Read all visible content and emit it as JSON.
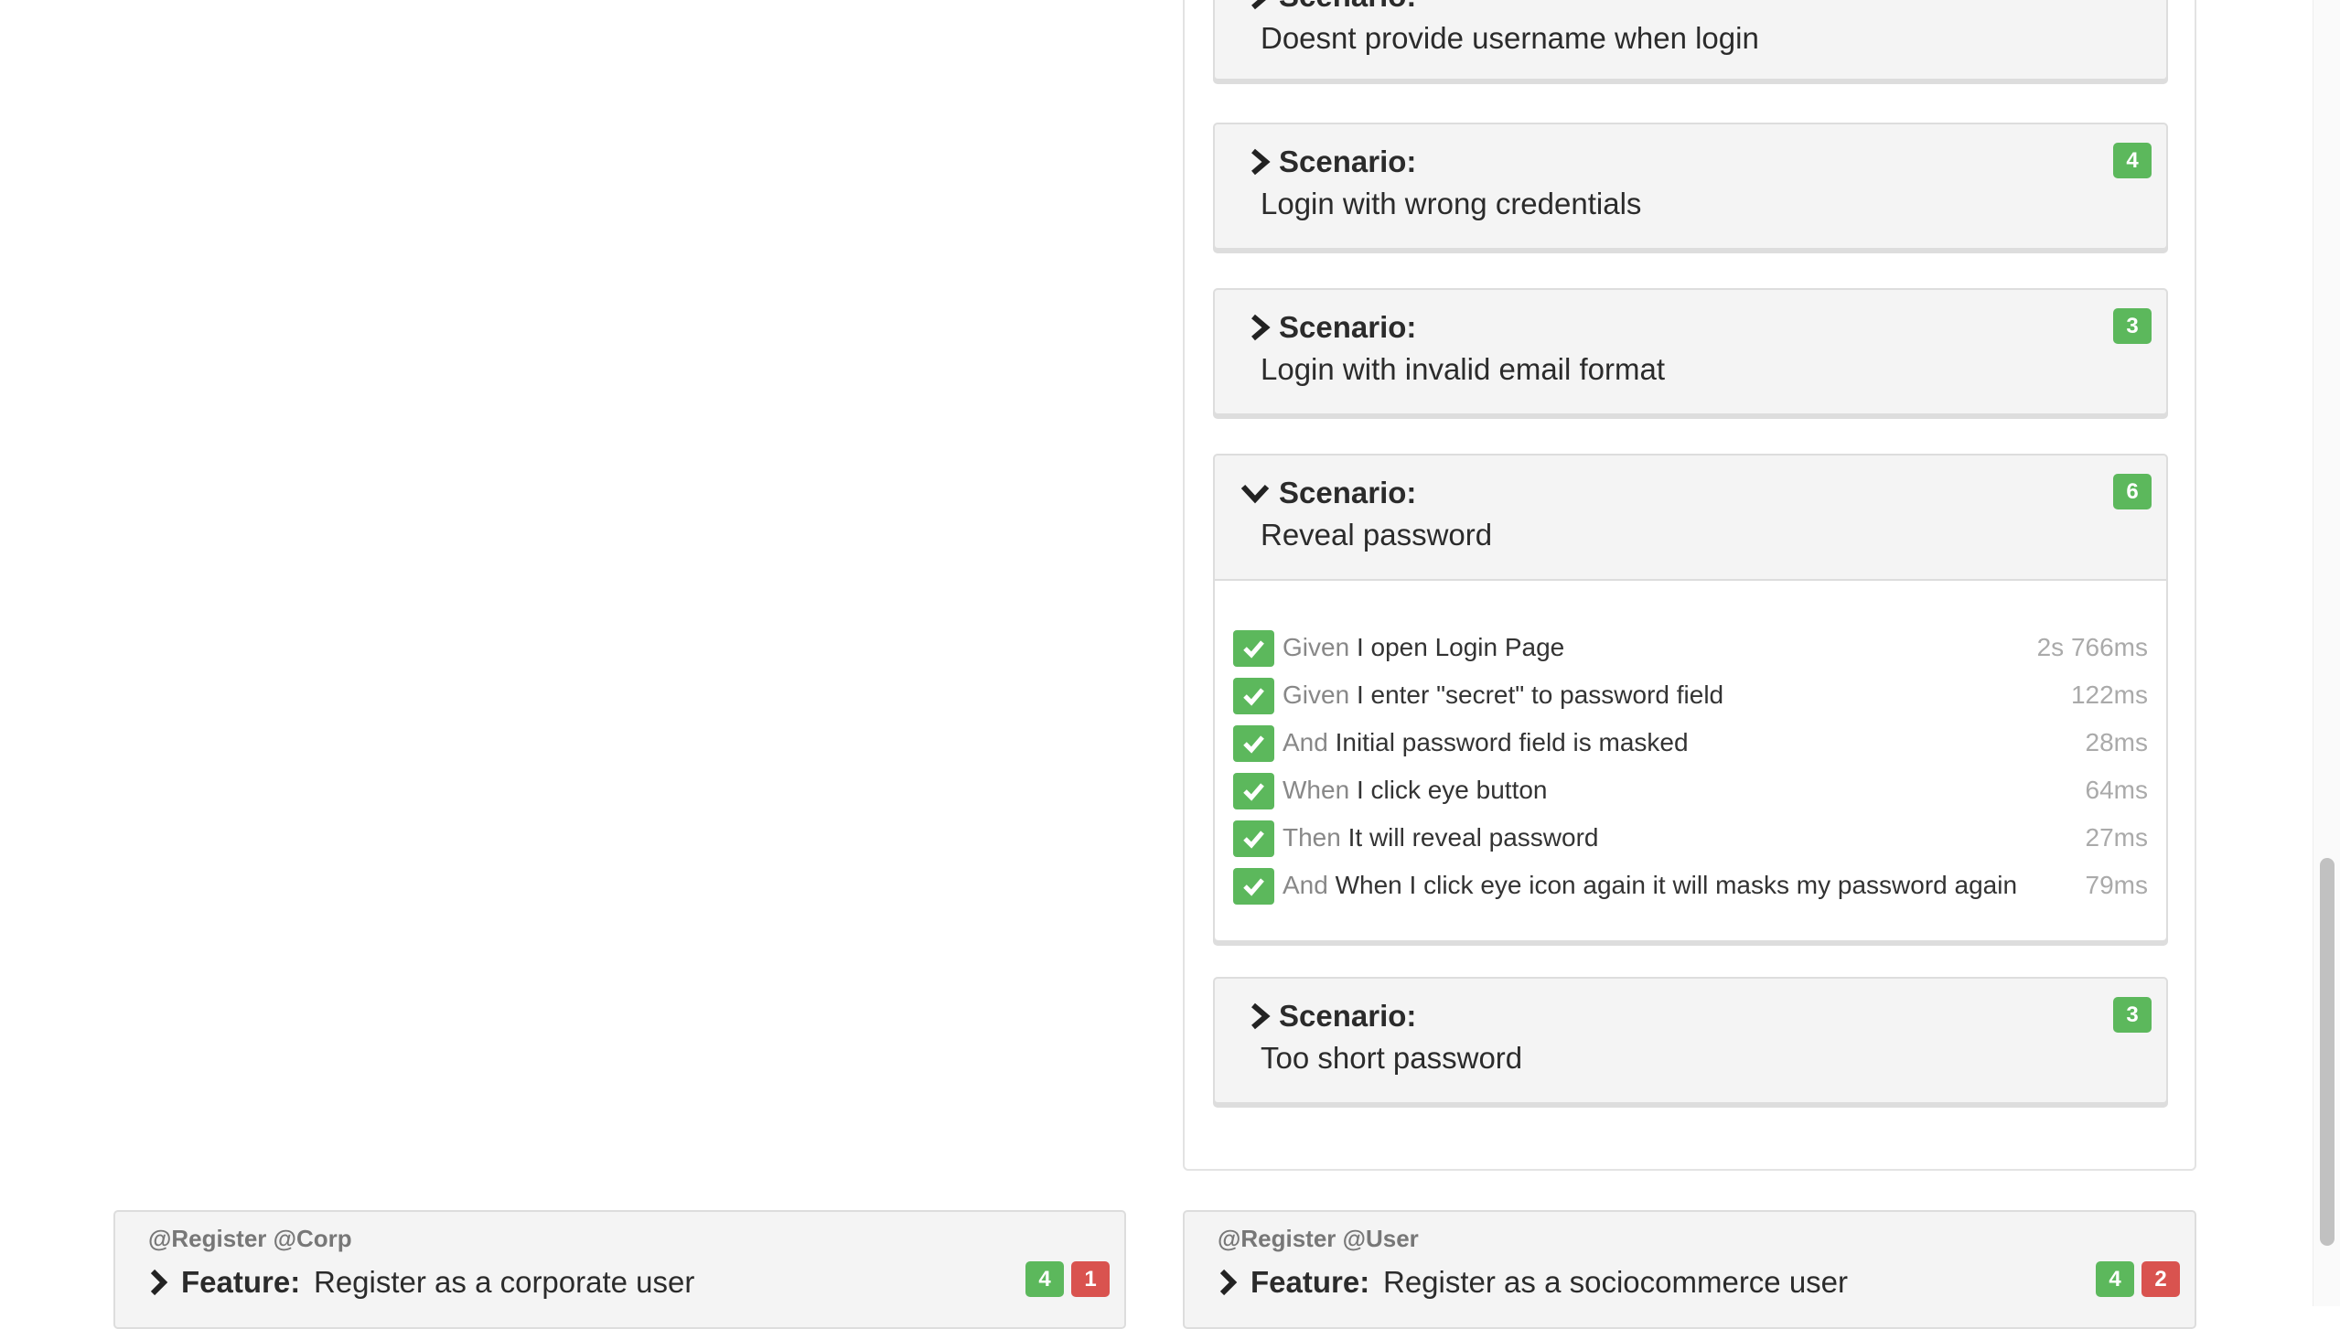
{
  "scenario_keyword": "Scenario:",
  "feature_keyword": "Feature:",
  "scenarios": [
    {
      "name": "Doesnt provide username when login",
      "passed": "",
      "expanded": false
    },
    {
      "name": "Login with wrong credentials",
      "passed": "4",
      "expanded": false
    },
    {
      "name": "Login with invalid email format",
      "passed": "3",
      "expanded": false
    },
    {
      "name": "Reveal password",
      "passed": "6",
      "expanded": true,
      "steps": [
        {
          "keyword": "Given",
          "text": "I open Login Page",
          "duration": "2s 766ms",
          "status": "passed"
        },
        {
          "keyword": "Given",
          "text": "I enter \"secret\" to password field",
          "duration": "122ms",
          "status": "passed"
        },
        {
          "keyword": "And",
          "text": "Initial password field is masked",
          "duration": "28ms",
          "status": "passed"
        },
        {
          "keyword": "When",
          "text": "I click eye button",
          "duration": "64ms",
          "status": "passed"
        },
        {
          "keyword": "Then",
          "text": "It will reveal password",
          "duration": "27ms",
          "status": "passed"
        },
        {
          "keyword": "And",
          "text": "When I click eye icon again it will masks my password again",
          "duration": "79ms",
          "status": "passed"
        }
      ]
    },
    {
      "name": "Too short password",
      "passed": "3",
      "expanded": false
    }
  ],
  "features": [
    {
      "tags": "@Register @Corp",
      "name": "Register as a corporate user",
      "passed": "4",
      "failed": "1"
    },
    {
      "tags": "@Register @User",
      "name": "Register as a sociocommerce user",
      "passed": "4",
      "failed": "2"
    }
  ],
  "colors": {
    "passed": "#5cb85c",
    "failed": "#d9534f",
    "panel": "#f4f4f4"
  }
}
